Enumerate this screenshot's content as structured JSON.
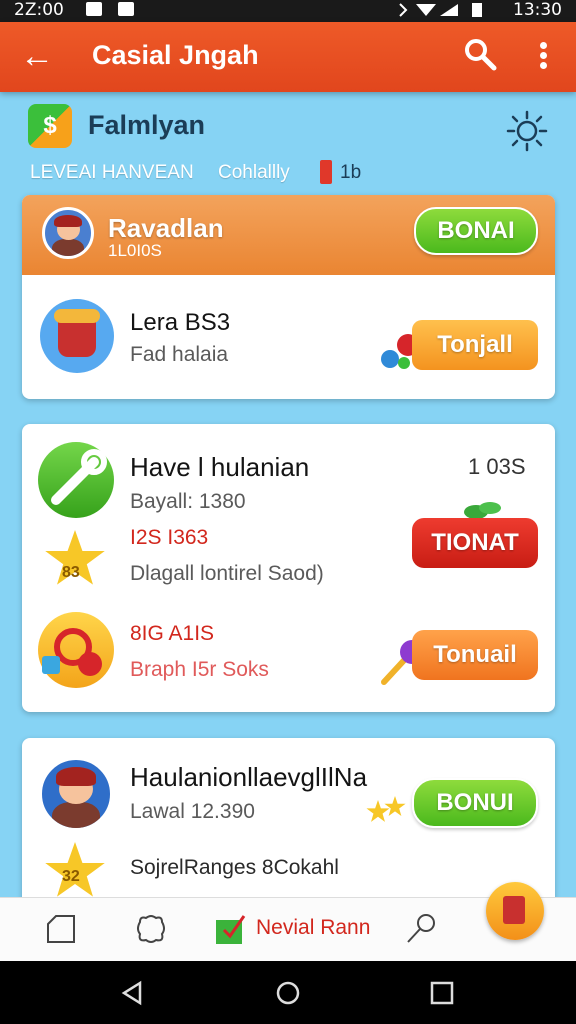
{
  "status_bar": {
    "time": "2Z:00",
    "right_time": "13:30"
  },
  "app_bar": {
    "title": "Casial Jngah"
  },
  "profile": {
    "logo_glyph": "$",
    "name": "Falmlyan"
  },
  "tabs": [
    {
      "label": "LEVEAI HANVEAN"
    },
    {
      "label": "Cohlallly"
    },
    {
      "label": "1b"
    }
  ],
  "card1": {
    "header": {
      "name": "Ravadlan",
      "sub": "1L0I0S",
      "button": "BONAI"
    },
    "row": {
      "title": "Lera BS3",
      "sub": "Fad halaia",
      "button": "Tonjall"
    }
  },
  "card2": {
    "row1": {
      "title": "Have l hulanian",
      "meta": "1 03S",
      "line1": "Bayall: 1380",
      "line2": "I2S I363",
      "line3": "Dlagall lontirel Saod)",
      "star_text": "83",
      "button": "TIONAT"
    },
    "row2": {
      "line1": "8IG A1IS",
      "line2": "Braph I5r Soks",
      "button": "Tonuail"
    }
  },
  "card3": {
    "title": "HaulanionllaevglIlNa",
    "sub": "Lawal 12.390",
    "star_text": "32",
    "line": "SojrelRanges 8Cokahl",
    "button": "BONUI"
  },
  "bottom_nav": {
    "active_label": "Nevial Rann"
  },
  "colors": {
    "app_bar": "#e8501f",
    "background": "#86d3f4",
    "accent_green": "#5ac423",
    "accent_red": "#d2271d"
  }
}
